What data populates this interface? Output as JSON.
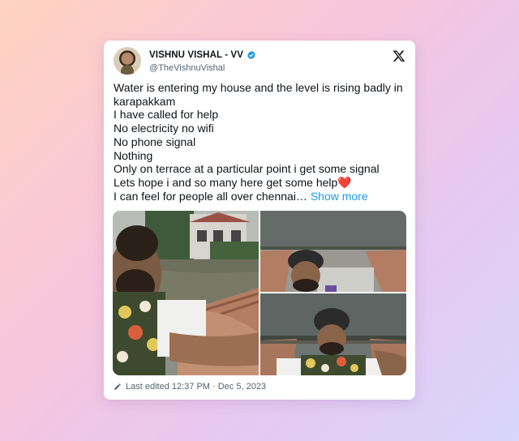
{
  "tweet": {
    "display_name": "VISHNU VISHAL - VV",
    "handle": "@TheVishnuVishal",
    "lines": [
      "Water is entering my house and the level is rising badly in karapakkam",
      "I have called for help",
      "No electricity no wifi",
      "No phone signal",
      "Nothing",
      "Only on terrace at a particular point i get some signal",
      "Lets hope i and so many here get some help",
      "I can feel for people all over chennai…"
    ],
    "heart_emoji": "❤️",
    "show_more": "Show more",
    "edited": "Last edited 12:37 PM · Dec 5, 2023"
  },
  "icons": {
    "verified": "verified-badge-icon",
    "x_logo": "x-logo-icon",
    "edit": "pencil-icon"
  },
  "colors": {
    "link": "#1d9bf0",
    "text": "#0f1419",
    "muted": "#536471",
    "verified": "#1d9bf0"
  }
}
